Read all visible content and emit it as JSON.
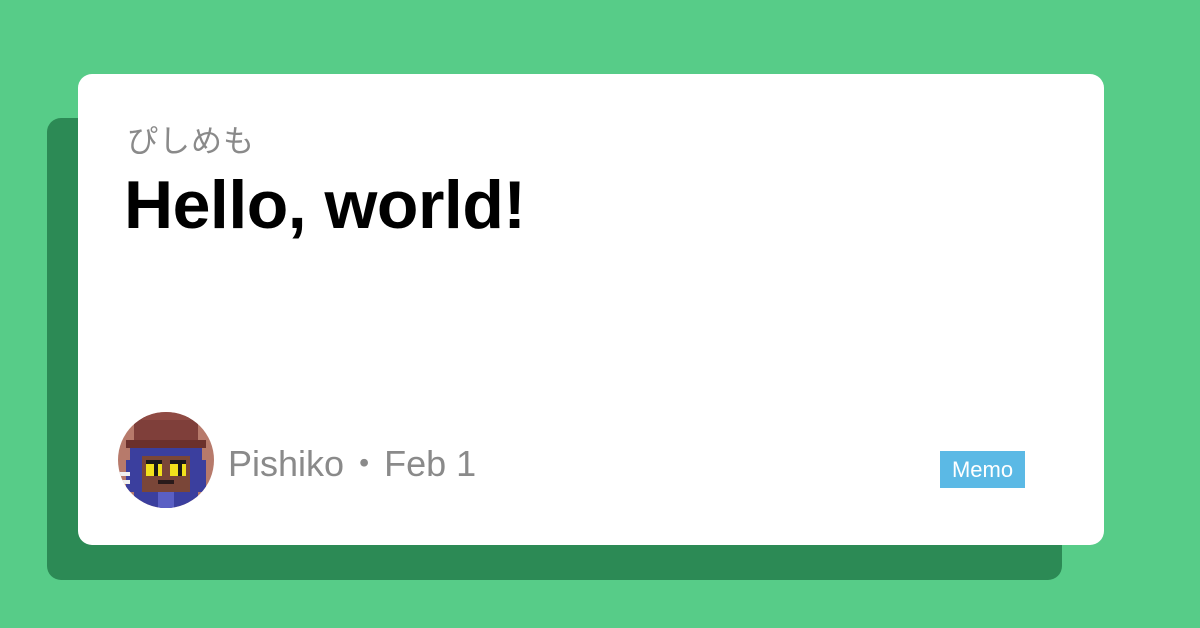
{
  "site": {
    "name": "ぴしめも"
  },
  "post": {
    "title": "Hello, world!",
    "author": "Pishiko",
    "separator": "・",
    "date": "Feb 1",
    "tag": "Memo"
  },
  "colors": {
    "background": "#57cc88",
    "card": "#ffffff",
    "card_shadow": "#2c8a55",
    "muted_text": "#8a8a8a",
    "tag_bg": "#5bb9e5"
  },
  "icons": {
    "avatar": "pixel-cat-avatar-icon"
  }
}
